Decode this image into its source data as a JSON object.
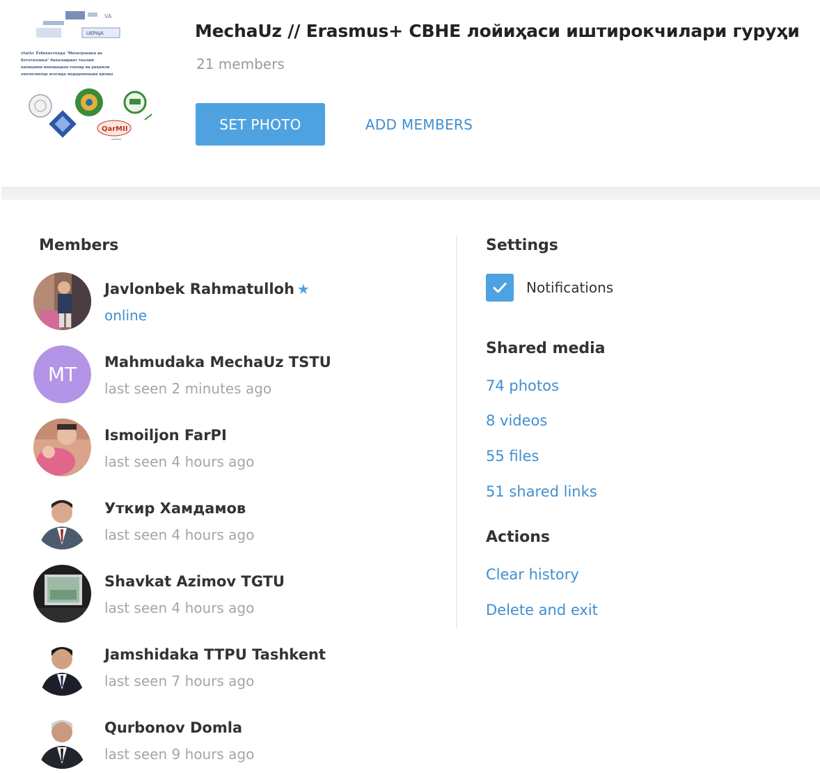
{
  "header": {
    "photo_alt_lines": [
      "chaUz: Ўзбекистонда \"Мехатроника ва",
      "бототехника\" бакалавриат таълим",
      "налишини инновацион ғоялар ва рақамли",
      "хнологиялар асосида модернизация қилиш"
    ],
    "photo_logo_text": "QarMII",
    "photo_badge_text": "UEPAJA",
    "title": "MechaUz // Erasmus+ CBHE лойиҳаси иштирокчилари гуруҳи",
    "member_count": "21 members",
    "set_photo_label": "SET PHOTO",
    "add_members_label": "ADD MEMBERS"
  },
  "members": {
    "heading": "Members",
    "list": [
      {
        "name": "Javlonbek Rahmatulloh",
        "status": "online",
        "is_online": true,
        "starred": true,
        "avatar": "photo"
      },
      {
        "name": "Mahmudaka MechaUz TSTU",
        "status": "last seen 2 minutes ago",
        "is_online": false,
        "starred": false,
        "avatar": "initials",
        "initials": "MT"
      },
      {
        "name": "Ismoiljon FarPI",
        "status": "last seen 4 hours ago",
        "is_online": false,
        "starred": false,
        "avatar": "photo"
      },
      {
        "name": "Уткир Хамдамов",
        "status": "last seen 4 hours ago",
        "is_online": false,
        "starred": false,
        "avatar": "photo"
      },
      {
        "name": "Shavkat Azimov TGTU",
        "status": "last seen 4 hours ago",
        "is_online": false,
        "starred": false,
        "avatar": "photo"
      },
      {
        "name": "Jamshidaka TTPU Tashkent",
        "status": "last seen 7 hours ago",
        "is_online": false,
        "starred": false,
        "avatar": "photo"
      },
      {
        "name": "Qurbonov Domla",
        "status": "last seen 9 hours ago",
        "is_online": false,
        "starred": false,
        "avatar": "photo"
      }
    ]
  },
  "settings": {
    "heading": "Settings",
    "notifications_label": "Notifications",
    "notifications_checked": true
  },
  "shared_media": {
    "heading": "Shared media",
    "photos": "74 photos",
    "videos": "8 videos",
    "files": "55 files",
    "links": "51 shared links"
  },
  "actions": {
    "heading": "Actions",
    "clear_history": "Clear history",
    "delete_and_exit": "Delete and exit"
  },
  "colors": {
    "accent": "#4ea2df",
    "link": "#3f8fd0",
    "muted": "#a5a5a5",
    "initials_avatar": "#b394e6"
  }
}
